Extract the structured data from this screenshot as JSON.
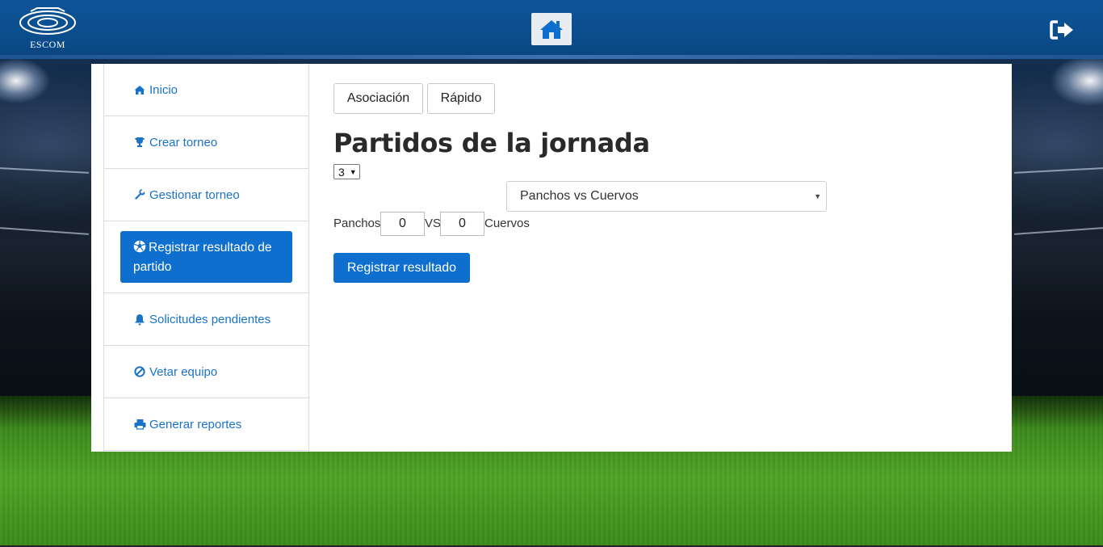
{
  "brand": {
    "logo_text": "ESCOM"
  },
  "icons": {
    "home": "home-icon",
    "logout": "sign-out-icon",
    "inicio": "home-icon",
    "crear": "trophy-icon",
    "gestionar": "wrench-icon",
    "registrar": "soccer-ball-icon",
    "solicitudes": "bell-icon",
    "vetar": "ban-icon",
    "reportes": "print-icon"
  },
  "colors": {
    "navbar": "#0b4f8f",
    "accent": "#0f6fcf",
    "link": "#1a73c7"
  },
  "sidebar": {
    "items": [
      {
        "label": "Inicio"
      },
      {
        "label": "Crear torneo"
      },
      {
        "label": "Gestionar torneo"
      },
      {
        "label": "Registrar resultado de partido",
        "active": true
      },
      {
        "label": "Solicitudes pendientes"
      },
      {
        "label": "Vetar equipo"
      },
      {
        "label": "Generar reportes"
      }
    ]
  },
  "main": {
    "tabs": [
      {
        "label": "Asociación"
      },
      {
        "label": "Rápido"
      }
    ],
    "title": "Partidos de la jornada",
    "jornada_selected": "3",
    "match_selected": "Panchos vs Cuervos",
    "home_team": "Panchos",
    "home_score": "0",
    "vs_label": "VS",
    "away_score": "0",
    "away_team": "Cuervos",
    "submit_label": "Registrar resultado"
  }
}
